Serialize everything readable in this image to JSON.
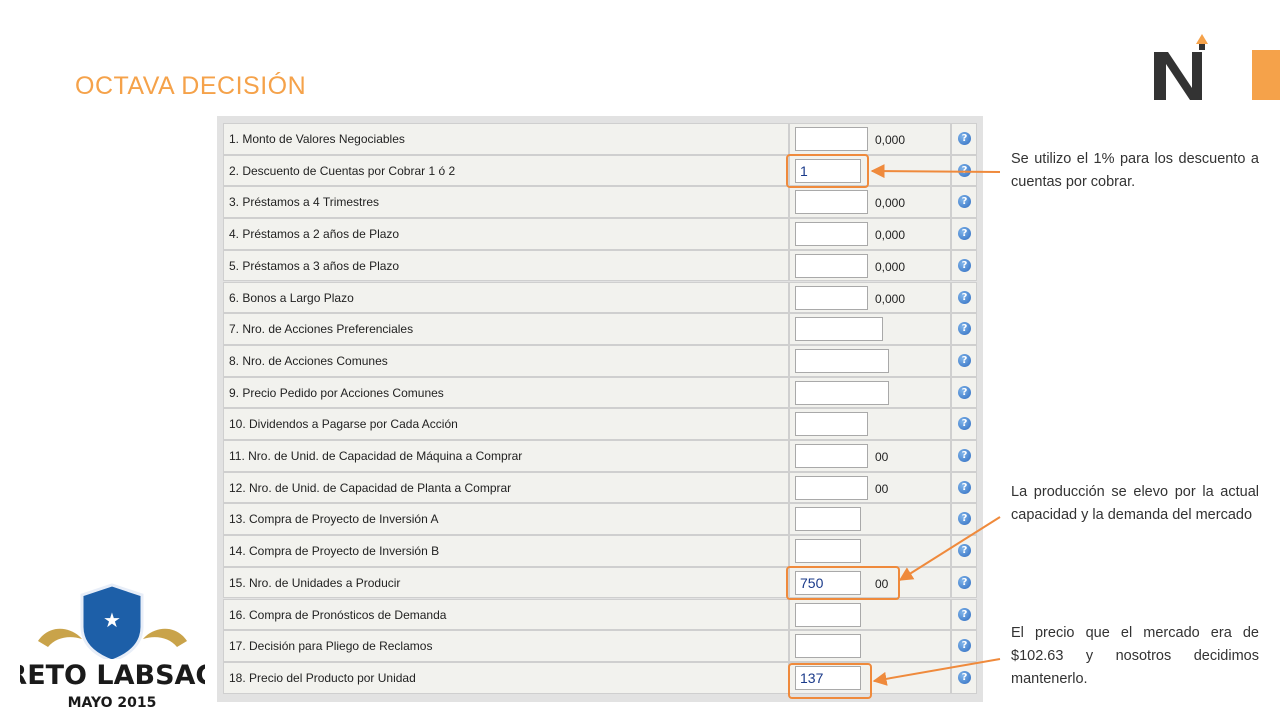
{
  "page": {
    "title": "OCTAVA DECISIÓN"
  },
  "form": {
    "rows": [
      {
        "label": "1. Monto de Valores Negociables",
        "value": "",
        "suffix": "0,000"
      },
      {
        "label": "2. Descuento de Cuentas por Cobrar 1 ó 2",
        "value": "1",
        "suffix": ""
      },
      {
        "label": "3. Préstamos a 4 Trimestres",
        "value": "",
        "suffix": "0,000"
      },
      {
        "label": "4. Préstamos a 2 años de Plazo",
        "value": "",
        "suffix": "0,000"
      },
      {
        "label": "5. Préstamos a 3 años de Plazo",
        "value": "",
        "suffix": "0,000"
      },
      {
        "label": "6. Bonos a Largo Plazo",
        "value": "",
        "suffix": "0,000"
      },
      {
        "label": "7. Nro. de Acciones Preferenciales",
        "value": "",
        "suffix": ""
      },
      {
        "label": "8. Nro. de Acciones Comunes",
        "value": "",
        "suffix": ""
      },
      {
        "label": "9. Precio Pedido por Acciones Comunes",
        "value": "",
        "suffix": ""
      },
      {
        "label": "10. Dividendos a Pagarse por Cada Acción",
        "value": "",
        "suffix": ""
      },
      {
        "label": "11. Nro. de Unid. de Capacidad de Máquina a Comprar",
        "value": "",
        "suffix": "00"
      },
      {
        "label": "12. Nro. de Unid. de Capacidad de Planta a Comprar",
        "value": "",
        "suffix": "00"
      },
      {
        "label": "13. Compra de Proyecto de Inversión A",
        "value": "",
        "suffix": ""
      },
      {
        "label": "14. Compra de Proyecto de Inversión B",
        "value": "",
        "suffix": ""
      },
      {
        "label": "15. Nro. de Unidades a Producir",
        "value": "750",
        "suffix": "00"
      },
      {
        "label": "16. Compra de Pronósticos de Demanda",
        "value": "",
        "suffix": ""
      },
      {
        "label": "17. Decisión para Pliego de Reclamos",
        "value": "",
        "suffix": ""
      },
      {
        "label": "18. Precio del Producto por Unidad",
        "value": "137",
        "suffix": ""
      }
    ],
    "help_glyph": "?"
  },
  "notes": {
    "discount": "Se utilizo el 1% para los descuento a cuentas por cobrar.",
    "production": "La producción se elevo por la actual capacidad y la demanda del mercado",
    "price": "El precio que el mercado era de $102.63 y nosotros decidimos mantenerlo."
  },
  "badge": {
    "line1": "RETO LABSAG",
    "line2": "MAYO 2015"
  },
  "colors": {
    "accent": "#f5a24a",
    "highlight": "#ef8a3c",
    "help": "#2f6cc0"
  }
}
